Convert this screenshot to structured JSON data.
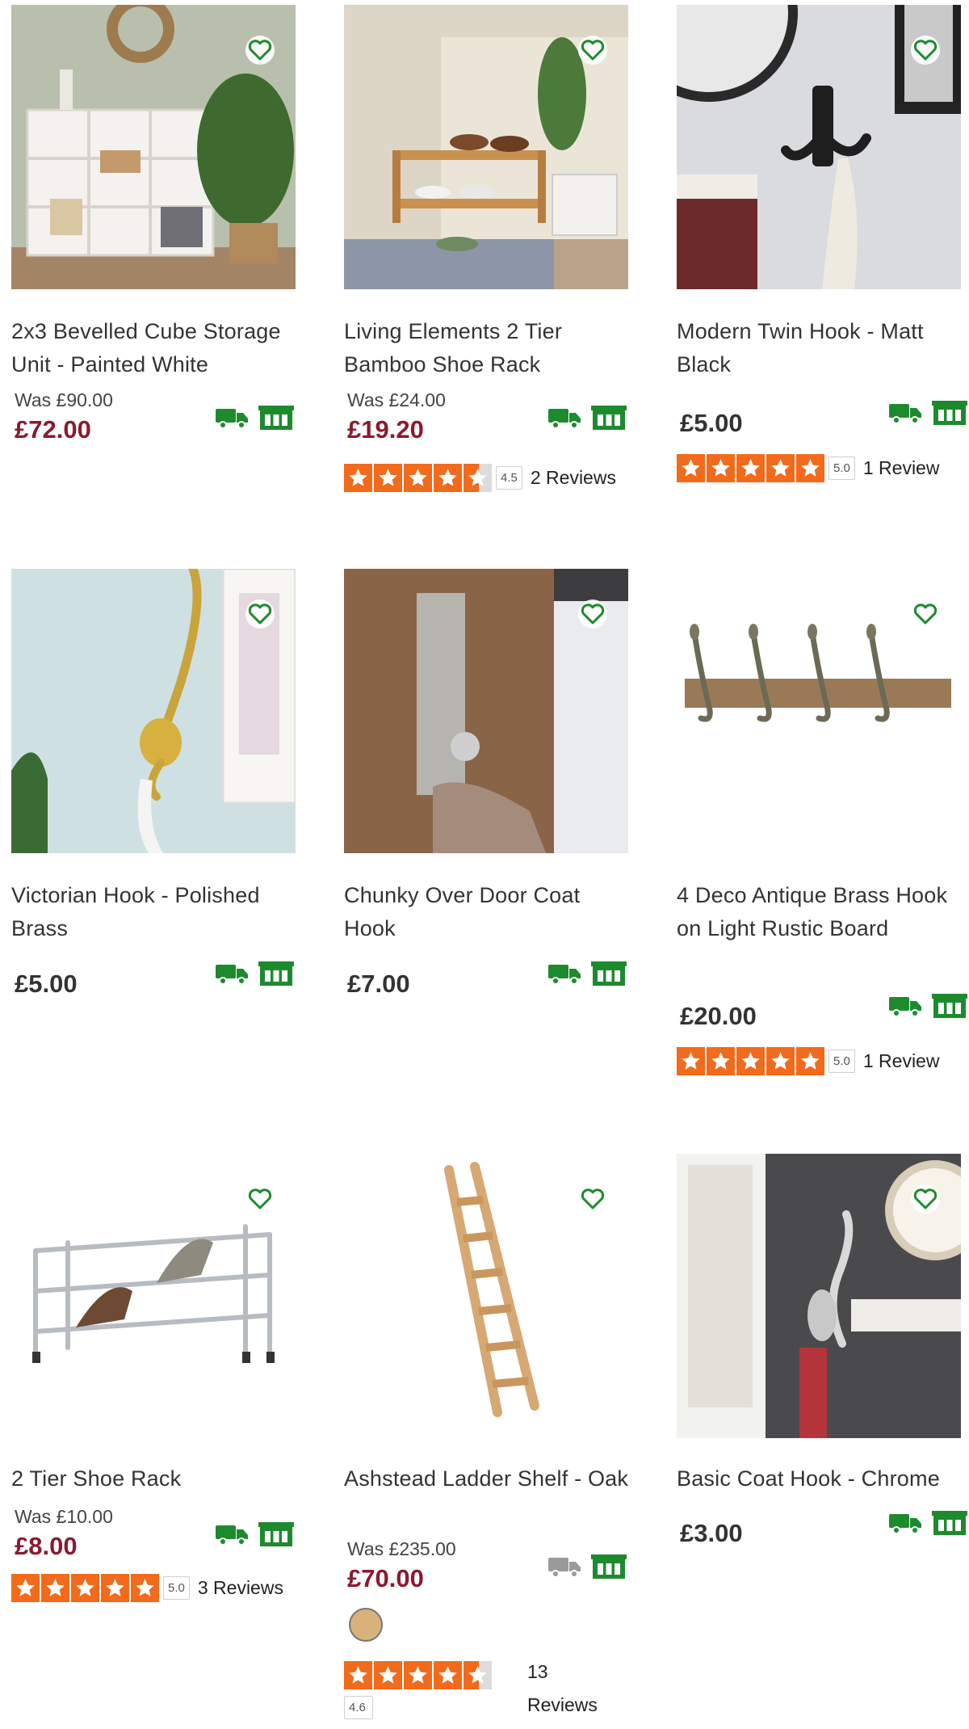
{
  "colors": {
    "green": "#1d8a2e",
    "sale_red": "#8b1a2e",
    "star_orange": "#f26a1b",
    "grey_icon": "#9a9a9a"
  },
  "products": [
    {
      "title": "2x3 Bevelled Cube Storage Unit - Painted White",
      "was": "Was £90.00",
      "price": "£72.00",
      "on_sale": true,
      "delivery": "green",
      "rating": null
    },
    {
      "title": "Living Elements 2 Tier Bamboo Shoe Rack",
      "was": "Was £24.00",
      "price": "£19.20",
      "on_sale": true,
      "delivery": "green",
      "rating": {
        "value": 4.5,
        "score": "4.5",
        "reviews": "2 Reviews"
      }
    },
    {
      "title": "Modern Twin Hook - Matt Black",
      "was": null,
      "price": "£5.00",
      "on_sale": false,
      "delivery": "green",
      "rating": {
        "value": 5.0,
        "score": "5.0",
        "reviews": "1 Review"
      }
    },
    {
      "title": "Victorian Hook - Polished Brass",
      "was": null,
      "price": "£5.00",
      "on_sale": false,
      "delivery": "green",
      "rating": null
    },
    {
      "title": "Chunky Over Door Coat Hook",
      "was": null,
      "price": "£7.00",
      "on_sale": false,
      "delivery": "green",
      "rating": null
    },
    {
      "title": "4 Deco Antique Brass Hook on Light Rustic Board",
      "was": null,
      "price": "£20.00",
      "on_sale": false,
      "delivery": "green",
      "rating": {
        "value": 5.0,
        "score": "5.0",
        "reviews": "1 Review"
      }
    },
    {
      "title": "2 Tier Shoe Rack",
      "was": "Was £10.00",
      "price": "£8.00",
      "on_sale": true,
      "delivery": "green",
      "rating": {
        "value": 5.0,
        "score": "5.0",
        "reviews": "3 Reviews"
      }
    },
    {
      "title": "Ashstead Ladder Shelf - Oak",
      "was": "Was £235.00",
      "price": "£70.00",
      "on_sale": true,
      "delivery": "grey",
      "swatch": "oak",
      "rating": {
        "value": 4.6,
        "score": "4.6",
        "reviews_count": "13",
        "reviews_word": "Reviews"
      }
    },
    {
      "title": "Basic Coat Hook - Chrome",
      "was": null,
      "price": "£3.00",
      "on_sale": false,
      "delivery": "green",
      "rating": null
    }
  ],
  "icons": {
    "wishlist": "heart-outline-icon",
    "home_delivery": "delivery-van-icon",
    "click_collect": "store-collect-icon",
    "star": "star-icon"
  }
}
